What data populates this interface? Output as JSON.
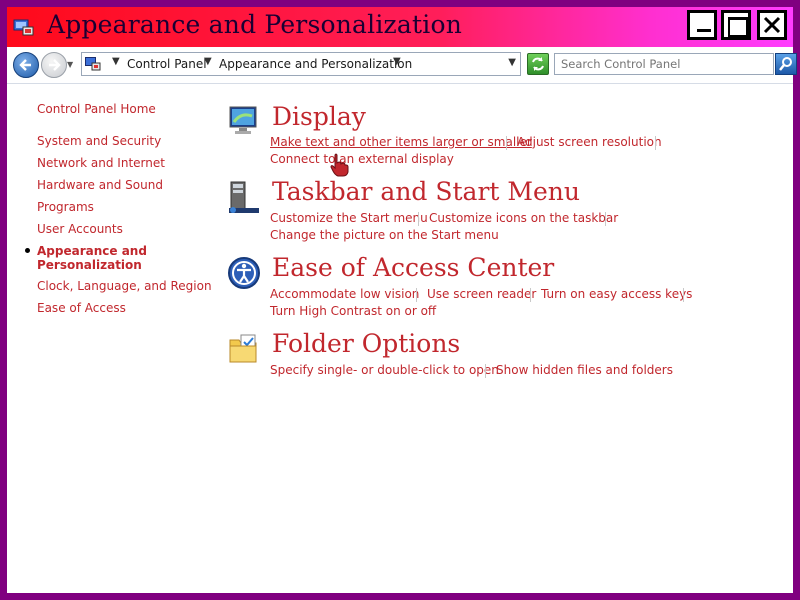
{
  "window": {
    "title": "Appearance and Personalization"
  },
  "address_bar": {
    "crumbs": [
      "Control Panel",
      "Appearance and Personalization"
    ],
    "search_placeholder": "Search Control Panel"
  },
  "sidebar": {
    "home": "Control Panel Home",
    "items": [
      "System and Security",
      "Network and Internet",
      "Hardware and Sound",
      "Programs",
      "User Accounts"
    ],
    "current": "Appearance and Personalization",
    "after": [
      "Clock, Language, and Region",
      "Ease of Access"
    ]
  },
  "categories": [
    {
      "title": "Display",
      "icon": "monitor-icon",
      "tasks": [
        "Make text and other items larger or smaller",
        "Adjust screen resolution",
        "Connect to an external display"
      ]
    },
    {
      "title": "Taskbar and Start Menu",
      "icon": "taskbar-icon",
      "tasks": [
        "Customize the Start menu",
        "Customize icons on the taskbar",
        "Change the picture on the Start menu"
      ]
    },
    {
      "title": "Ease of Access Center",
      "icon": "ease-of-access-icon",
      "tasks": [
        "Accommodate low vision",
        "Use screen reader",
        "Turn on easy access keys",
        "Turn High Contrast on or off"
      ]
    },
    {
      "title": "Folder Options",
      "icon": "folder-icon",
      "tasks": [
        "Specify single- or double-click to open",
        "Show hidden files and folders"
      ]
    }
  ],
  "colors": {
    "link": "#c1272d",
    "frame": "#800080",
    "title_gradient_start": "#ff0a1a",
    "title_gradient_end": "#ff3cff"
  }
}
